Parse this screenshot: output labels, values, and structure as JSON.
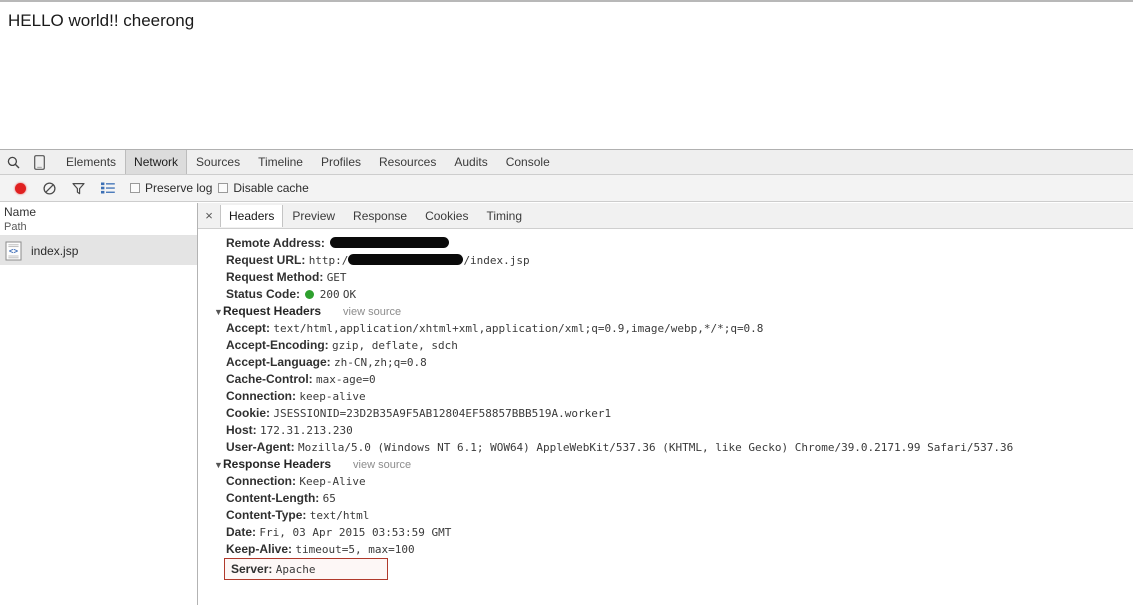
{
  "page": {
    "content_text": "HELLO world!! cheerong"
  },
  "devtools": {
    "toolbar_icons": {
      "search": "search-icon",
      "device": "device-toggle-icon",
      "record": "record-button",
      "clear": "clear-icon",
      "filter": "filter-icon",
      "view_list": "view-list-icon"
    },
    "tabs": [
      {
        "label": "Elements",
        "selected": false
      },
      {
        "label": "Network",
        "selected": true
      },
      {
        "label": "Sources",
        "selected": false
      },
      {
        "label": "Timeline",
        "selected": false
      },
      {
        "label": "Profiles",
        "selected": false
      },
      {
        "label": "Resources",
        "selected": false
      },
      {
        "label": "Audits",
        "selected": false
      },
      {
        "label": "Console",
        "selected": false
      }
    ],
    "network_toolbar": {
      "preserve_log_label": "Preserve log",
      "preserve_log_checked": false,
      "disable_cache_label": "Disable cache",
      "disable_cache_checked": false
    },
    "request_list": {
      "column_name": "Name",
      "column_path": "Path",
      "rows": [
        {
          "name": "index.jsp",
          "selected": true
        }
      ]
    },
    "detail": {
      "close_label": "×",
      "tabs": [
        {
          "label": "Headers",
          "selected": true
        },
        {
          "label": "Preview",
          "selected": false
        },
        {
          "label": "Response",
          "selected": false
        },
        {
          "label": "Cookies",
          "selected": false
        },
        {
          "label": "Timing",
          "selected": false
        }
      ],
      "general": {
        "remote_address_label": "Remote Address:",
        "remote_address_value": "",
        "request_url_label": "Request URL:",
        "request_url_scheme": "http:/",
        "request_url_path": "/index.jsp",
        "request_method_label": "Request Method:",
        "request_method_value": "GET",
        "status_code_label": "Status Code:",
        "status_code_value": "200",
        "status_code_text": "OK",
        "status_color": "#2ea02e"
      },
      "request_headers": {
        "title": "Request Headers",
        "view_source": "view source",
        "items": [
          {
            "name": "Accept:",
            "value": "text/html,application/xhtml+xml,application/xml;q=0.9,image/webp,*/*;q=0.8"
          },
          {
            "name": "Accept-Encoding:",
            "value": "gzip, deflate, sdch"
          },
          {
            "name": "Accept-Language:",
            "value": "zh-CN,zh;q=0.8"
          },
          {
            "name": "Cache-Control:",
            "value": "max-age=0"
          },
          {
            "name": "Connection:",
            "value": "keep-alive"
          },
          {
            "name": "Cookie:",
            "value": "JSESSIONID=23D2B35A9F5AB12804EF58857BBB519A.worker1"
          },
          {
            "name": "Host:",
            "value": "172.31.213.230"
          },
          {
            "name": "User-Agent:",
            "value": "Mozilla/5.0 (Windows NT 6.1; WOW64) AppleWebKit/537.36 (KHTML, like Gecko) Chrome/39.0.2171.99 Safari/537.36"
          }
        ]
      },
      "response_headers": {
        "title": "Response Headers",
        "view_source": "view source",
        "items": [
          {
            "name": "Connection:",
            "value": "Keep-Alive"
          },
          {
            "name": "Content-Length:",
            "value": "65"
          },
          {
            "name": "Content-Type:",
            "value": "text/html"
          },
          {
            "name": "Date:",
            "value": "Fri, 03 Apr 2015 03:53:59 GMT"
          },
          {
            "name": "Keep-Alive:",
            "value": "timeout=5, max=100"
          }
        ],
        "highlighted": {
          "name": "Server:",
          "value": "Apache",
          "highlight_color": "#b0392b"
        }
      }
    }
  }
}
